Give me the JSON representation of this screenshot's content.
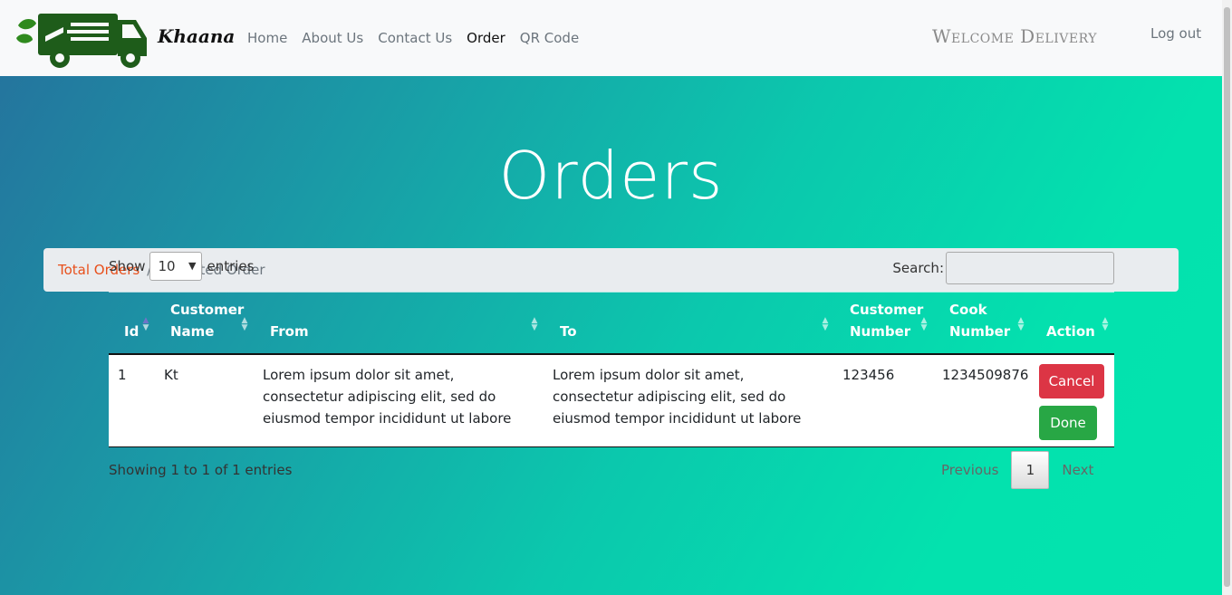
{
  "nav": {
    "brand": "Khaana",
    "links": [
      "Home",
      "About Us",
      "Contact Us",
      "Order",
      "QR Code"
    ],
    "active": "Order",
    "welcome": "Welcome Delivery",
    "logout": "Log out"
  },
  "page": {
    "title": "Orders"
  },
  "breadcrumb": {
    "link": "Total Orders",
    "separator": "/",
    "current": "Accepted Order"
  },
  "datatable": {
    "show_label": "Show",
    "entries_value": "10",
    "entries_label": "entries",
    "search_label": "Search:",
    "search_value": "",
    "columns": [
      {
        "line1": "",
        "line2": "Id"
      },
      {
        "line1": "Customer",
        "line2": "Name"
      },
      {
        "line1": "",
        "line2": "From"
      },
      {
        "line1": "",
        "line2": "To"
      },
      {
        "line1": "Customer",
        "line2": "Number"
      },
      {
        "line1": "Cook",
        "line2": "Number"
      },
      {
        "line1": "",
        "line2": "Action"
      }
    ],
    "rows": [
      {
        "id": "1",
        "customer_name": "Kt",
        "from": "Lorem ipsum dolor sit amet, consectetur adipiscing elit, sed do eiusmod tempor incididunt ut labore",
        "to": "Lorem ipsum dolor sit amet, consectetur adipiscing elit, sed do eiusmod tempor incididunt ut labore",
        "customer_number": "123456",
        "cook_number": "1234509876",
        "cancel_label": "Cancel",
        "done_label": "Done"
      }
    ],
    "info": "Showing 1 to 1 of 1 entries",
    "pagination": {
      "previous": "Previous",
      "current": "1",
      "next": "Next"
    }
  },
  "colors": {
    "accent_link": "#e8501c",
    "cancel": "#dc3545",
    "done": "#28a745",
    "logo_green": "#1e5c1a"
  }
}
